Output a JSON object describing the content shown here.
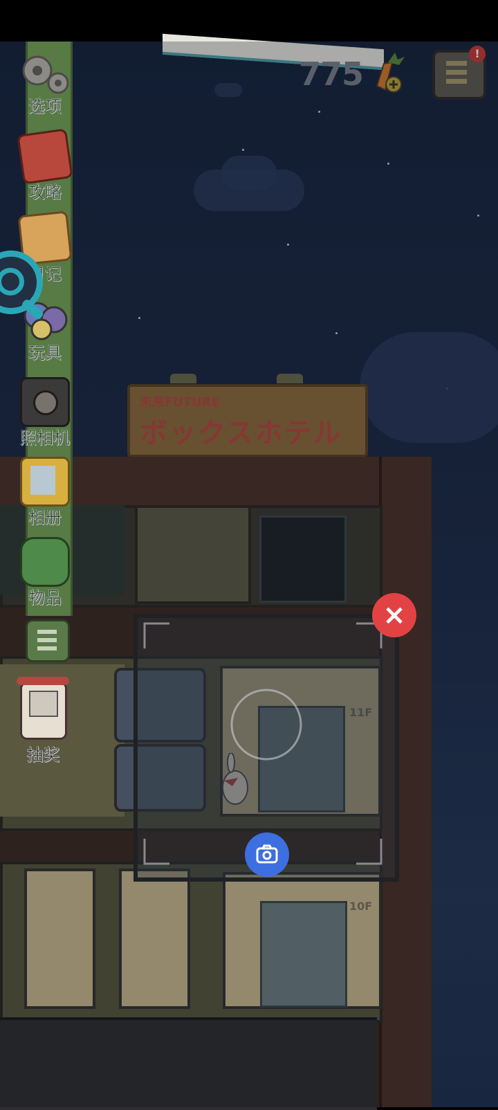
{
  "currency": {
    "carrot_count": "775"
  },
  "sidebar": {
    "items": [
      {
        "label": "选项",
        "icon": "gear-icon"
      },
      {
        "label": "攻略",
        "icon": "guide-book-icon"
      },
      {
        "label": "日记",
        "icon": "diary-icon"
      },
      {
        "label": "玩具",
        "icon": "toys-icon"
      },
      {
        "label": "照相机",
        "icon": "camera-icon"
      },
      {
        "label": "相册",
        "icon": "photo-album-icon"
      },
      {
        "label": "物品",
        "icon": "backpack-icon"
      }
    ],
    "collapse_icon": "menu-list-icon"
  },
  "lottery": {
    "label": "抽奖",
    "icon": "lottery-machine-icon"
  },
  "hotel": {
    "sign_small": "未来FUTURE",
    "sign_big": "ボックスホテル",
    "floors": [
      "11F",
      "10F"
    ]
  },
  "camera_mode": {
    "close_label": "×",
    "shutter_icon": "camera-shutter-icon"
  },
  "colors": {
    "sidebar": "#587a45",
    "close": "#e34244",
    "shutter": "#3d6fe0",
    "sky": "#1c2a45"
  }
}
